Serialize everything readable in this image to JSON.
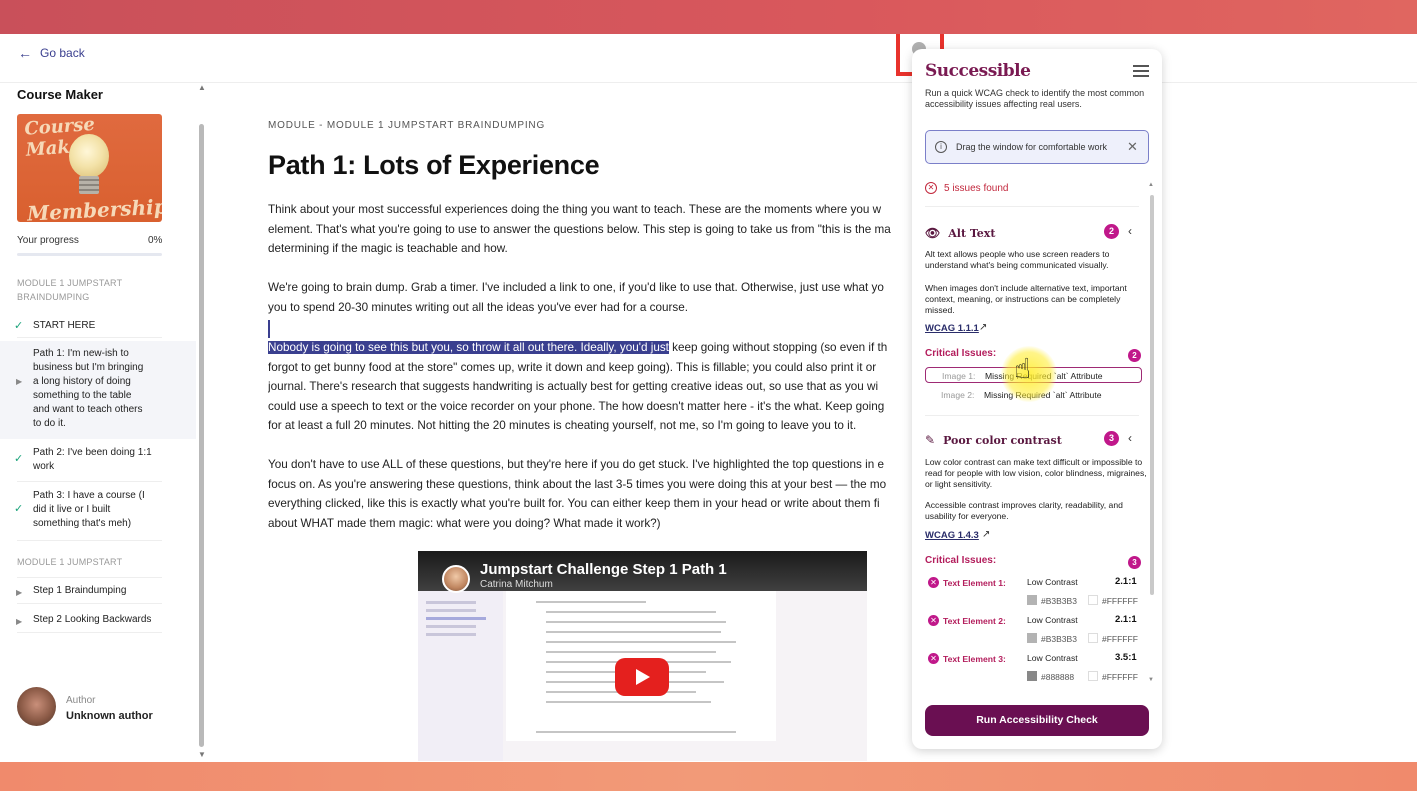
{
  "nav": {
    "back_label": "Go back"
  },
  "sidebar": {
    "course_title": "Course Maker",
    "thumbnail_text_top": "Course Maker",
    "thumbnail_text_bottom": "Membership",
    "progress_label": "Your progress",
    "progress_value": "0%",
    "progress_fraction": 0,
    "module1_heading_line1": "MODULE 1 JUMPSTART",
    "module1_heading_line2": "BRAINDUMPING",
    "items": [
      {
        "label": "START HERE",
        "state": "complete"
      },
      {
        "label_lines": [
          "Path 1: I'm new-ish to",
          "business but I'm bringing",
          "a long history of doing",
          "something to the table",
          "and want to teach others",
          "to do it."
        ],
        "state": "current"
      },
      {
        "label_lines": [
          "Path 2: I've been doing 1:1",
          "work"
        ],
        "state": "complete"
      },
      {
        "label_lines": [
          "Path 3: I have a course (I",
          "did it live or I built",
          "something that's meh)"
        ],
        "state": "complete"
      }
    ],
    "module2_heading": "MODULE 1 JUMPSTART",
    "module2_items": [
      {
        "label": "Step 1 Braindumping"
      },
      {
        "label": "Step 2 Looking Backwards"
      }
    ],
    "author_label": "Author",
    "author_name": "Unknown author"
  },
  "lesson": {
    "module_label": "MODULE - MODULE 1 JUMPSTART BRAINDUMPING",
    "title": "Path 1: Lots of Experience",
    "para1": [
      "Think about your most successful experiences doing the thing you want to teach. These are the moments where you w",
      "element. That's what you're going to use to answer the questions below. This step is going to take us from \"this is the ma",
      "determining if the magic is teachable and how."
    ],
    "para2": [
      " We're going to brain dump. Grab a timer. I've included a link to one, if you'd like to use that. Otherwise, just use what yo",
      "you to spend 20-30 minutes writing out all the ideas you've ever had for a course."
    ],
    "para3_highlighted": "Nobody is going to see this but you, so throw it all out there. Ideally, you'd just",
    "para3_first_rest": " keep going without stopping (so even if th",
    "para3": [
      "forgot to get bunny food at the store\" comes up, write it down and keep going). This is fillable; you could also print it or",
      "journal. There's research that suggests handwriting is actually best for getting creative ideas out, so use that as you wi",
      "could use a speech to text or the voice recorder on your phone. The how doesn't matter here - it's the what. Keep going",
      "for at least a full 20 minutes. Not hitting the 20 minutes is cheating yourself, not me, so I'm going to leave you to it."
    ],
    "para4": [
      " You don't have to use ALL of these questions, but they're here if you do get stuck. I've highlighted the top questions in e",
      "focus on. As you're answering these questions, think about the last 3-5 times you were doing this at your best — the mo",
      "everything clicked, like this is exactly what you're built for. You can either keep them in your head or write about them fi",
      "about WHAT made them magic: what were you doing? What made it work?)"
    ],
    "video": {
      "title": "Jumpstart Challenge Step 1 Path 1",
      "author": "Catrina Mitchum"
    }
  },
  "extension": {
    "logo": "Successible",
    "intro": "Run a quick WCAG check to identify the most common accessibility issues affecting real users.",
    "drag_notice": "Drag the window for comfortable work",
    "issues_found": "5 issues found",
    "alt_text": {
      "heading": "Alt Text",
      "count": "2",
      "desc1": "Alt text allows people who use screen readers to understand what's being communicated visually.",
      "desc2": "When images don't include alternative text, important context, meaning, or instructions can be completely missed.",
      "wcag": "WCAG 1.1.1",
      "critical_label": "Critical Issues:",
      "critical_count": "2",
      "issues": [
        {
          "name": "Image 1:",
          "desc": "Missing Required `alt` Attribute"
        },
        {
          "name": "Image 2:",
          "desc": "Missing Required `alt` Attribute"
        }
      ]
    },
    "contrast": {
      "heading": "Poor color contrast",
      "count": "3",
      "desc1": "Low color contrast can make text difficult or impossible to read for people with low vision, color blindness, migraines, or light sensitivity.",
      "desc2": "Accessible contrast improves clarity, readability, and usability for everyone.",
      "wcag": "WCAG 1.4.3",
      "critical_label": "Critical Issues:",
      "critical_count": "3",
      "issues": [
        {
          "name": "Text Element 1:",
          "status": "Low Contrast",
          "ratio": "2.1:1",
          "fg": "#B3B3B3",
          "bg": "#FFFFFF"
        },
        {
          "name": "Text Element 2:",
          "status": "Low Contrast",
          "ratio": "2.1:1",
          "fg": "#B3B3B3",
          "bg": "#FFFFFF"
        },
        {
          "name": "Text Element 3:",
          "status": "Low Contrast",
          "ratio": "3.5:1",
          "fg": "#888888",
          "bg": "#FFFFFF"
        }
      ]
    },
    "run_button": "Run Accessibility Check"
  },
  "colors": {
    "accent": "#3a3f8f",
    "brand": "#6a0f52",
    "badge": "#c0188a",
    "critical": "#b31d5c",
    "complete_check": "#1aa37a"
  }
}
